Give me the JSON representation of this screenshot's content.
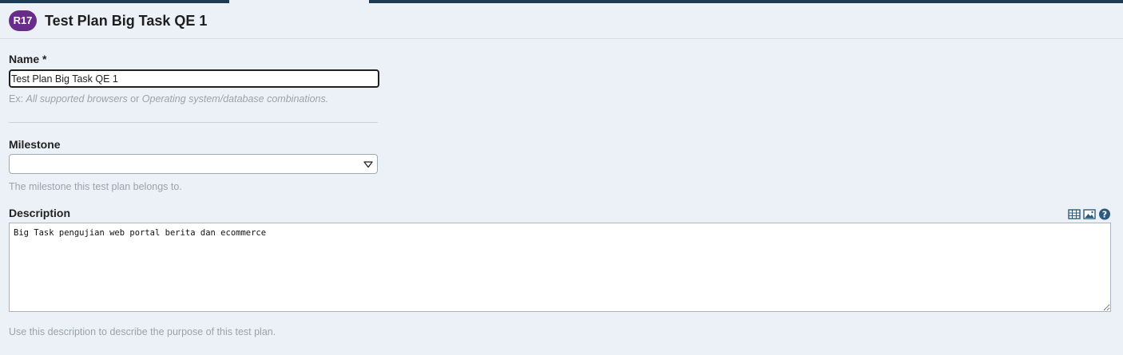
{
  "header": {
    "badge": "R17",
    "title": "Test Plan Big Task QE 1"
  },
  "name_field": {
    "label": "Name *",
    "value": "Test Plan Big Task QE 1",
    "hint_prefix": "Ex: ",
    "hint_example": "All supported browsers",
    "hint_or": " or ",
    "hint_example2": "Operating system/database combinations."
  },
  "milestone_field": {
    "label": "Milestone",
    "selected": "",
    "hint": "The milestone this test plan belongs to."
  },
  "description_field": {
    "label": "Description",
    "value": "Big Task pengujian web portal berita dan ecommerce",
    "hint": "Use this description to describe the purpose of this test plan.",
    "toolbar_icons": [
      "table-icon",
      "image-icon",
      "help-icon"
    ]
  },
  "colors": {
    "topbar": "#1b3b57",
    "badge": "#6a2c8b",
    "background": "#ebf1f7",
    "icon_blue": "#2b5a7e"
  }
}
